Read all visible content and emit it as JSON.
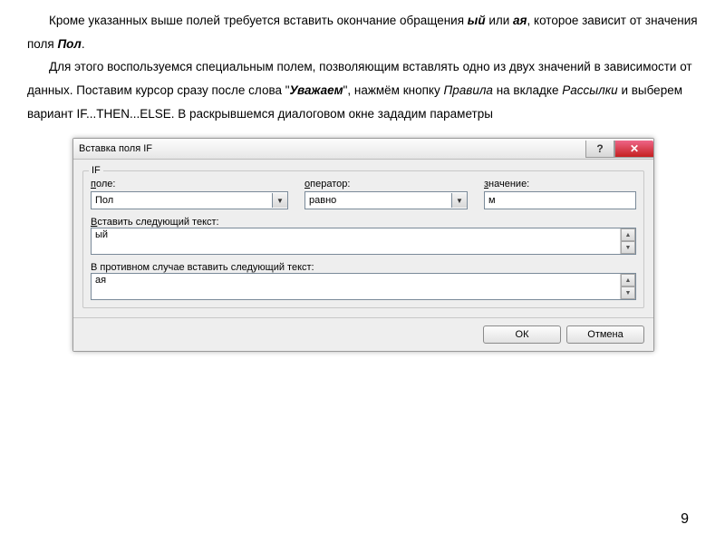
{
  "doc": {
    "p1_1": "Кроме указанных выше полей требуется вставить окончание обращения ",
    "p1_em1": "ый",
    "p1_2": " или ",
    "p1_em2": "ая",
    "p1_3": ", которое зависит от значения поля ",
    "p1_em3": "Пол",
    "p1_4": ".",
    "p2_1": "Для этого воспользуемся  специальным полем, позволяющим вставлять одно из двух значений в зависимости от данных. Поставим курсор сразу после слова \"",
    "p2_em1": "Уважаем",
    "p2_2": "\", нажмём кнопку ",
    "p2_em2": "Правила",
    "p2_3": " на вкладке ",
    "p2_em3": "Рассылки",
    "p2_4": " и выберем вариант ",
    "p2_em4": "IF...THEN...ELSE",
    "p2_5": ". В раскрывшемся диалоговом окне зададим параметры"
  },
  "dialog": {
    "title": "Вставка поля IF",
    "help_icon": "?",
    "close_icon": "✕",
    "group_legend": "IF",
    "field_label_u": "п",
    "field_label_rest": "оле:",
    "field_value": "Пол",
    "operator_label_u": "о",
    "operator_label_rest": "ператор:",
    "operator_value": "равно",
    "value_label_u": "з",
    "value_label_rest": "начение:",
    "value_value": "м",
    "insert_true_label_u": "В",
    "insert_true_label_rest": "ставить следующий текст:",
    "insert_true_value": "ый",
    "insert_false_label": "В противном случае вставить следующий текст:",
    "insert_false_value": "ая",
    "ok": "ОК",
    "cancel": "Отмена"
  },
  "page_number": "9"
}
